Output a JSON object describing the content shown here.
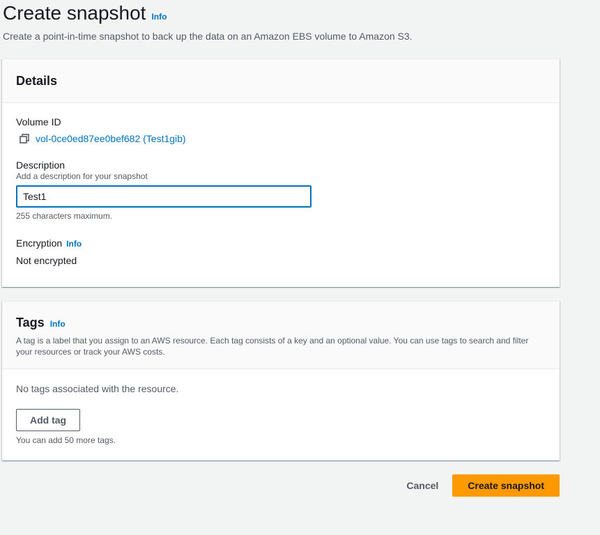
{
  "header": {
    "title": "Create snapshot",
    "info_label": "Info",
    "subtitle": "Create a point-in-time snapshot to back up the data on an Amazon EBS volume to Amazon S3."
  },
  "details": {
    "title": "Details",
    "volume_id_label": "Volume ID",
    "volume_id_icon": "copy-icon",
    "volume_id_value": "vol-0ce0ed87ee0bef682 (Test1gib)",
    "description_label": "Description",
    "description_hint": "Add a description for your snapshot",
    "description_value": "Test1",
    "description_constraint": "255 characters maximum.",
    "encryption_label": "Encryption",
    "encryption_info": "Info",
    "encryption_value": "Not encrypted"
  },
  "tags": {
    "title": "Tags",
    "info_label": "Info",
    "description": "A tag is a label that you assign to an AWS resource. Each tag consists of a key and an optional value. You can use tags to search and filter your resources or track your AWS costs.",
    "empty_text": "No tags associated with the resource.",
    "add_button": "Add tag",
    "limit_text": "You can add 50 more tags."
  },
  "actions": {
    "cancel": "Cancel",
    "submit": "Create snapshot"
  },
  "colors": {
    "link": "#0073bb",
    "primary_button": "#ff9900",
    "background": "#f2f3f3"
  }
}
